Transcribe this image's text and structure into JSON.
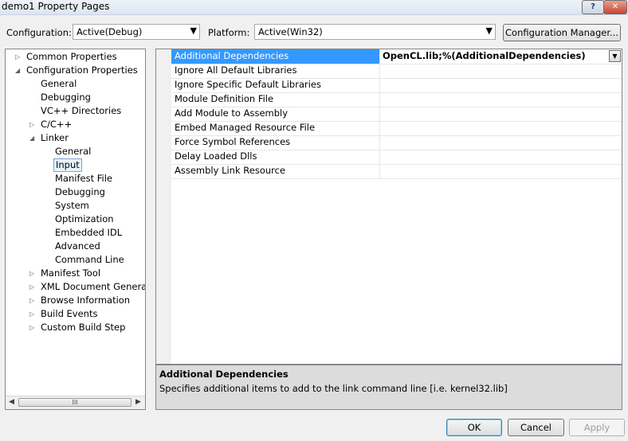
{
  "window": {
    "title": "demo1 Property Pages",
    "help_glyph": "?",
    "close_glyph": "✕"
  },
  "config_bar": {
    "configuration_label": "Configuration:",
    "configuration_value": "Active(Debug)",
    "platform_label": "Platform:",
    "platform_value": "Active(Win32)",
    "manager_button": "Configuration Manager..."
  },
  "tree": {
    "items": [
      {
        "label": "Common Properties",
        "expander": "▷"
      },
      {
        "label": "Configuration Properties",
        "expander": "◢"
      },
      {
        "label": "General",
        "expander": ""
      },
      {
        "label": "Debugging",
        "expander": ""
      },
      {
        "label": "VC++ Directories",
        "expander": ""
      },
      {
        "label": "C/C++",
        "expander": "▷"
      },
      {
        "label": "Linker",
        "expander": "◢"
      },
      {
        "label": "General",
        "expander": ""
      },
      {
        "label": "Input",
        "expander": ""
      },
      {
        "label": "Manifest File",
        "expander": ""
      },
      {
        "label": "Debugging",
        "expander": ""
      },
      {
        "label": "System",
        "expander": ""
      },
      {
        "label": "Optimization",
        "expander": ""
      },
      {
        "label": "Embedded IDL",
        "expander": ""
      },
      {
        "label": "Advanced",
        "expander": ""
      },
      {
        "label": "Command Line",
        "expander": ""
      },
      {
        "label": "Manifest Tool",
        "expander": "▷"
      },
      {
        "label": "XML Document Generator",
        "expander": "▷"
      },
      {
        "label": "Browse Information",
        "expander": "▷"
      },
      {
        "label": "Build Events",
        "expander": "▷"
      },
      {
        "label": "Custom Build Step",
        "expander": "▷"
      }
    ],
    "selected": "Input",
    "scroll_left": "◀",
    "scroll_right": "▶",
    "scroll_grip": "III"
  },
  "properties": {
    "rows": [
      {
        "name": "Additional Dependencies",
        "value": "OpenCL.lib;%(AdditionalDependencies)"
      },
      {
        "name": "Ignore All Default Libraries",
        "value": ""
      },
      {
        "name": "Ignore Specific Default Libraries",
        "value": ""
      },
      {
        "name": "Module Definition File",
        "value": ""
      },
      {
        "name": "Add Module to Assembly",
        "value": ""
      },
      {
        "name": "Embed Managed Resource File",
        "value": ""
      },
      {
        "name": "Force Symbol References",
        "value": ""
      },
      {
        "name": "Delay Loaded Dlls",
        "value": ""
      },
      {
        "name": "Assembly Link Resource",
        "value": ""
      }
    ],
    "dropdown_glyph": "▼"
  },
  "description": {
    "title": "Additional Dependencies",
    "text": "Specifies additional items to add to the link command line [i.e. kernel32.lib]"
  },
  "buttons": {
    "ok": "OK",
    "cancel": "Cancel",
    "apply": "Apply"
  },
  "colors": {
    "selection": "#3399ff",
    "disabled_text": "#a0a0a0"
  }
}
